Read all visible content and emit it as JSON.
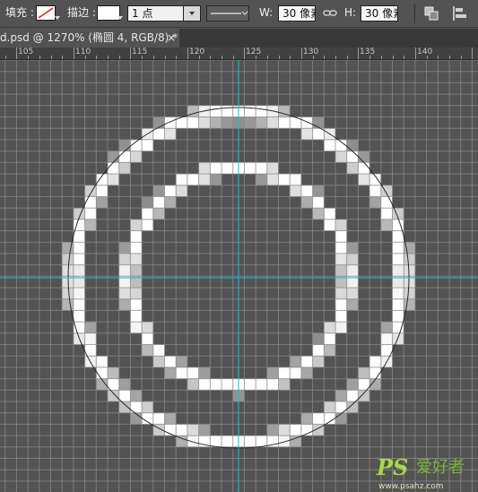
{
  "options_bar": {
    "fill_label": "填充 :",
    "stroke_label": "描边 :",
    "stroke_width_value": "1 点",
    "w_label": "W:",
    "w_value": "30 像素",
    "h_label": "H:",
    "h_value": "30 像素"
  },
  "document_tab": {
    "title": "d.psd @ 1270% (椭圆 4, RGB/8) *",
    "close_glyph": "×"
  },
  "ruler": {
    "labels": [
      "105",
      "110",
      "115",
      "120",
      "125",
      "130",
      "135",
      "140"
    ]
  },
  "canvas": {
    "guide_color": "#00c8d8",
    "background_color": "#535353",
    "grid_color": "#8a8a8a"
  },
  "watermark": {
    "logo": "PS",
    "name": "爱好者",
    "url": "www.psahz.com"
  },
  "icons": [
    "fill-none-icon",
    "stroke-swatch-icon",
    "stroke-style-icon",
    "link-icon",
    "path-operations-icon",
    "path-alignment-icon",
    "close-icon"
  ]
}
